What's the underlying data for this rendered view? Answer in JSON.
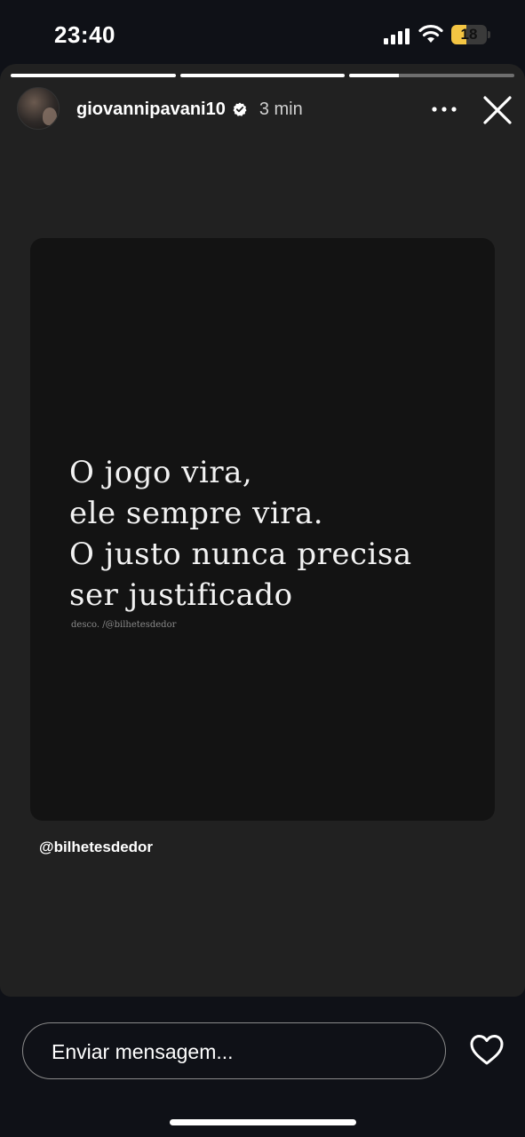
{
  "status_bar": {
    "time": "23:40",
    "battery_level": "18",
    "battery_fraction": 0.18,
    "battery_color": "#f4c543"
  },
  "story": {
    "progress_segments": [
      1.0,
      1.0,
      0.3
    ],
    "user": {
      "username": "giovannipavani10",
      "verified": true,
      "time_ago": "3 min"
    },
    "icons": {
      "more": "more-options-icon",
      "close": "close-icon",
      "verified": "verified-badge-icon"
    },
    "quote": {
      "lines": [
        "O jogo vira,",
        "ele sempre vira.",
        "O justo nunca precisa",
        "ser justificado"
      ],
      "credit": "desco. /@bilhetesdedor"
    },
    "mention": "@bilhetesdedor"
  },
  "reply": {
    "placeholder": "Enviar mensagem...",
    "like_icon": "heart-icon"
  },
  "colors": {
    "background": "#0f1117",
    "story_bg": "#212121",
    "card_bg": "#131313"
  }
}
